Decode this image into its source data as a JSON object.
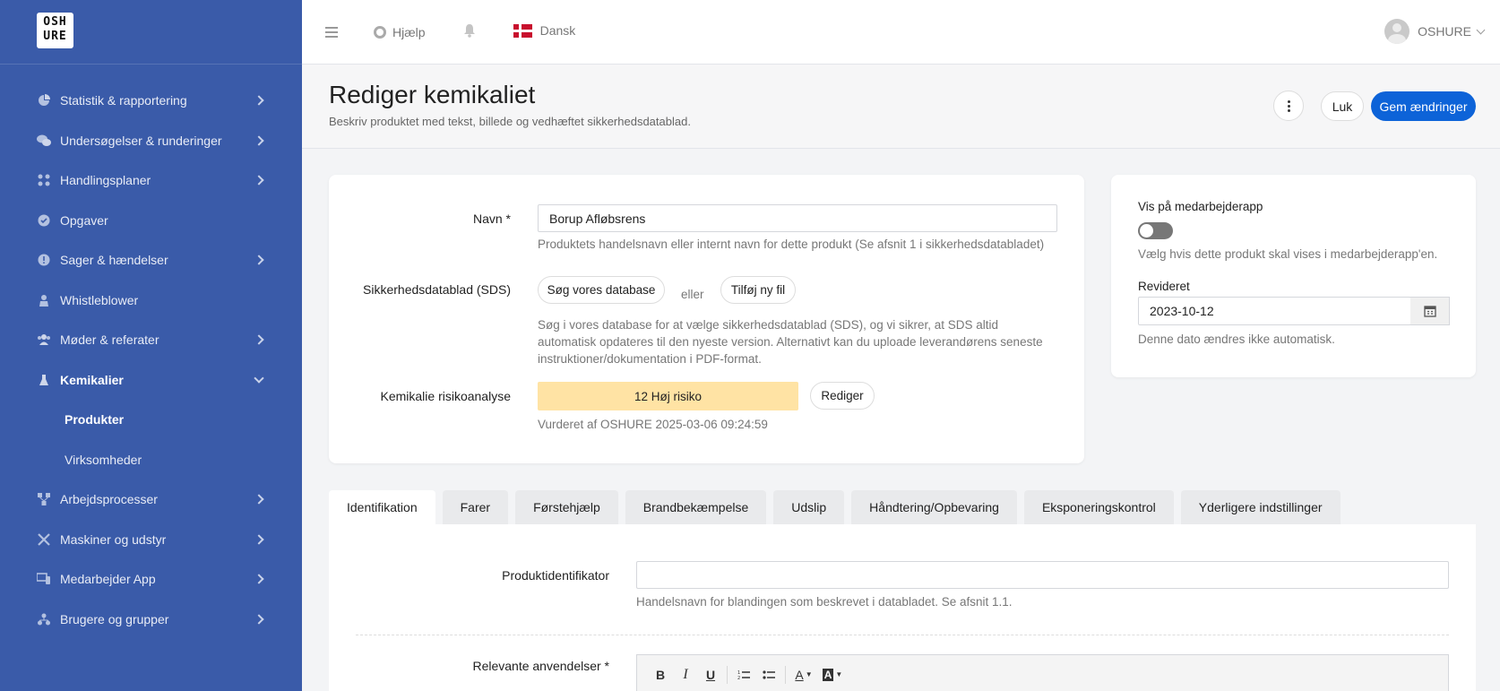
{
  "logo": {
    "line1": "OSH",
    "line2": "URE"
  },
  "sidebar": {
    "items": [
      {
        "label": "Statistik & rapportering"
      },
      {
        "label": "Undersøgelser & runderinger"
      },
      {
        "label": "Handlingsplaner"
      },
      {
        "label": "Opgaver"
      },
      {
        "label": "Sager & hændelser"
      },
      {
        "label": "Whistleblower"
      },
      {
        "label": "Møder & referater"
      },
      {
        "label": "Kemikalier"
      },
      {
        "label": "Produkter"
      },
      {
        "label": "Virksomheder"
      },
      {
        "label": "Arbejdsprocesser"
      },
      {
        "label": "Maskiner og udstyr"
      },
      {
        "label": "Medarbejder App"
      },
      {
        "label": "Brugere og grupper"
      }
    ]
  },
  "topbar": {
    "help": "Hjælp",
    "language": "Dansk",
    "user": "OSHURE"
  },
  "header": {
    "title": "Rediger kemikaliet",
    "subtitle": "Beskriv produktet med tekst, billede og vedhæftet sikkerhedsdatablad.",
    "close_label": "Luk",
    "save_label": "Gem ændringer"
  },
  "form": {
    "name_label": "Navn *",
    "name_value": "Borup Afløbsrens",
    "name_help": "Produktets handelsnavn eller internt navn for dette produkt (Se afsnit 1 i sikkerhedsdatabladet)",
    "sds_label": "Sikkerhedsdatablad (SDS)",
    "sds_search": "Søg vores database",
    "sds_or": "eller",
    "sds_add": "Tilføj ny fil",
    "sds_help": "Søg i vores database for at vælge sikkerhedsdatablad (SDS), og vi sikrer, at SDS altid automatisk opdateres til den nyeste version. Alternativt kan du uploade leverandørens seneste instruktioner/dokumentation i PDF-format.",
    "risk_label": "Kemikalie risikoanalyse",
    "risk_value": "12 Høj risiko",
    "risk_edit": "Rediger",
    "risk_note": "Vurderet af OSHURE 2025-03-06 09:24:59"
  },
  "side": {
    "show_label": "Vis på medarbejderapp",
    "show_help": "Vælg hvis dette produkt skal vises i medarbejderapp'en.",
    "show_enabled": false,
    "revised_label": "Revideret",
    "revised_value": "2023-10-12",
    "revised_help": "Denne dato ændres ikke automatisk."
  },
  "tabs": [
    {
      "label": "Identifikation"
    },
    {
      "label": "Farer"
    },
    {
      "label": "Førstehjælp"
    },
    {
      "label": "Brandbekæmpelse"
    },
    {
      "label": "Udslip"
    },
    {
      "label": "Håndtering/Opbevaring"
    },
    {
      "label": "Eksponeringskontrol"
    },
    {
      "label": "Yderligere indstillinger"
    }
  ],
  "tab_panel": {
    "product_id_label": "Produktidentifikator",
    "product_id_value": "",
    "product_id_help": "Handelsnavn for blandingen som beskrevet i databladet. Se afsnit 1.1.",
    "uses_label": "Relevante anvendelser *",
    "editor_buttons": {
      "bold": "B",
      "italic": "I",
      "underline": "U",
      "font_color": "A",
      "highlight": "A"
    }
  },
  "colors": {
    "sidebar": "#3a5ba9",
    "primary": "#0d63d8",
    "risk": "#ffe3a4"
  }
}
